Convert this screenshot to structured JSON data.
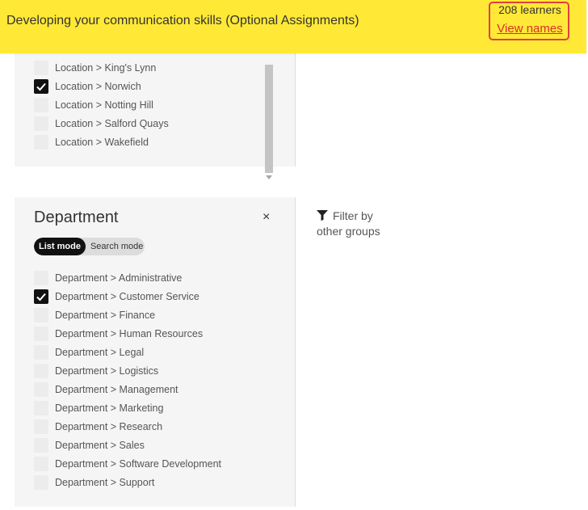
{
  "banner": {
    "title": "Developing your communication skills (Optional Assignments)",
    "learners_count": "208 learners",
    "view_names": "View names"
  },
  "location_panel": {
    "items": [
      {
        "label": "Location > King's Lynn",
        "checked": false
      },
      {
        "label": "Location > Norwich",
        "checked": true
      },
      {
        "label": "Location > Notting Hill",
        "checked": false
      },
      {
        "label": "Location > Salford Quays",
        "checked": false
      },
      {
        "label": "Location > Wakefield",
        "checked": false
      }
    ]
  },
  "department_panel": {
    "title": "Department",
    "close": "×",
    "modes": {
      "list": "List mode",
      "search": "Search mode",
      "active": "list"
    },
    "items": [
      {
        "label": "Department > Administrative",
        "checked": false
      },
      {
        "label": "Department > Customer Service",
        "checked": true
      },
      {
        "label": "Department > Finance",
        "checked": false
      },
      {
        "label": "Department > Human Resources",
        "checked": false
      },
      {
        "label": "Department > Legal",
        "checked": false
      },
      {
        "label": "Department > Logistics",
        "checked": false
      },
      {
        "label": "Department > Management",
        "checked": false
      },
      {
        "label": "Department > Marketing",
        "checked": false
      },
      {
        "label": "Department > Research",
        "checked": false
      },
      {
        "label": "Department > Sales",
        "checked": false
      },
      {
        "label": "Department > Software Development",
        "checked": false
      },
      {
        "label": "Department > Support",
        "checked": false
      }
    ]
  },
  "filter_other": {
    "line1": "Filter by",
    "line2": "other groups"
  },
  "colors": {
    "banner": "#ffe936",
    "highlight": "#e04040",
    "link": "#d9302a",
    "panel": "#f5f5f5"
  }
}
